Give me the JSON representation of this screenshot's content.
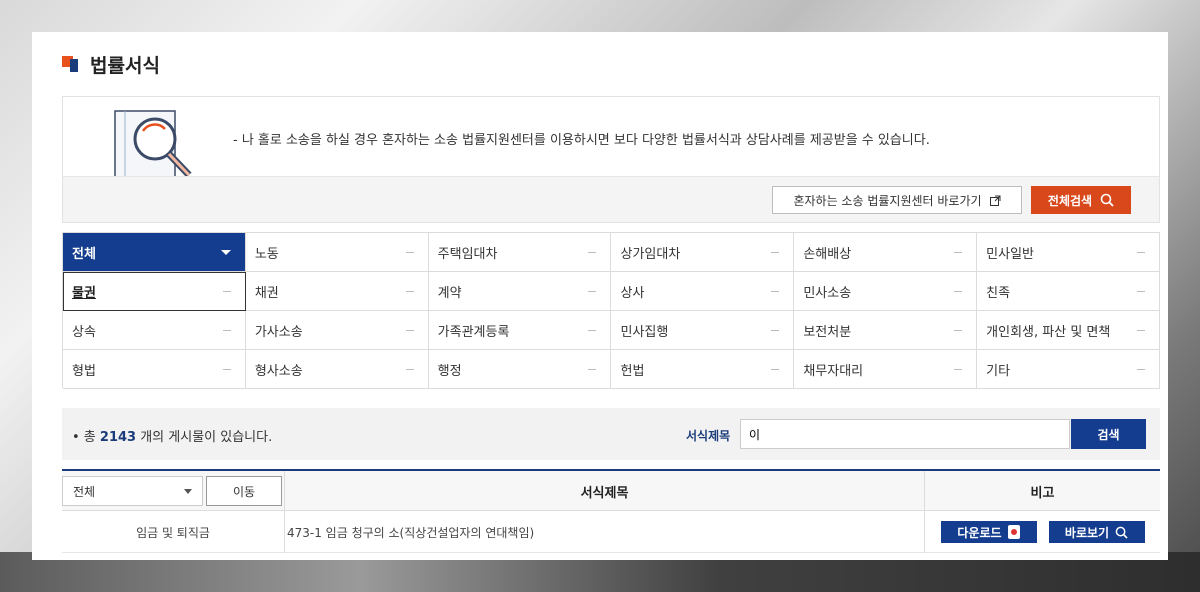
{
  "page": {
    "title": "법률서식"
  },
  "intro": {
    "text": "- 나 홀로 소송을 하실 경우 혼자하는 소송 법률지원센터를 이용하시면 보다 다양한 법률서식과 상담사례를 제공받을 수 있습니다.",
    "link_label": "혼자하는 소송 법률지원센터 바로가기",
    "search_all_label": "전체검색"
  },
  "categories": [
    "전체",
    "노동",
    "주택임대차",
    "상가임대차",
    "손해배상",
    "민사일반",
    "물권",
    "채권",
    "계약",
    "상사",
    "민사소송",
    "친족",
    "상속",
    "가사소송",
    "가족관계등록",
    "민사집행",
    "보전처분",
    "개인회생, 파산 및 면책",
    "형법",
    "형사소송",
    "행정",
    "헌법",
    "채무자대리",
    "기타"
  ],
  "search": {
    "count_prefix": "• 총 ",
    "count": "2143",
    "count_suffix": " 개의 게시물이 있습니다.",
    "field_label": "서식제목",
    "field_value": "이",
    "button_label": "검색"
  },
  "table": {
    "select_value": "전체",
    "move_label": "이동",
    "col_title": "서식제목",
    "col_note": "비고",
    "rows": [
      {
        "category": "임금 및 퇴직금",
        "title": "473-1 임금 청구의 소(직상건설업자의 연대책임)",
        "download_label": "다운로드",
        "view_label": "바로보기"
      }
    ]
  },
  "colors": {
    "brand_navy": "#143d8f",
    "accent_orange": "#d9481a"
  }
}
